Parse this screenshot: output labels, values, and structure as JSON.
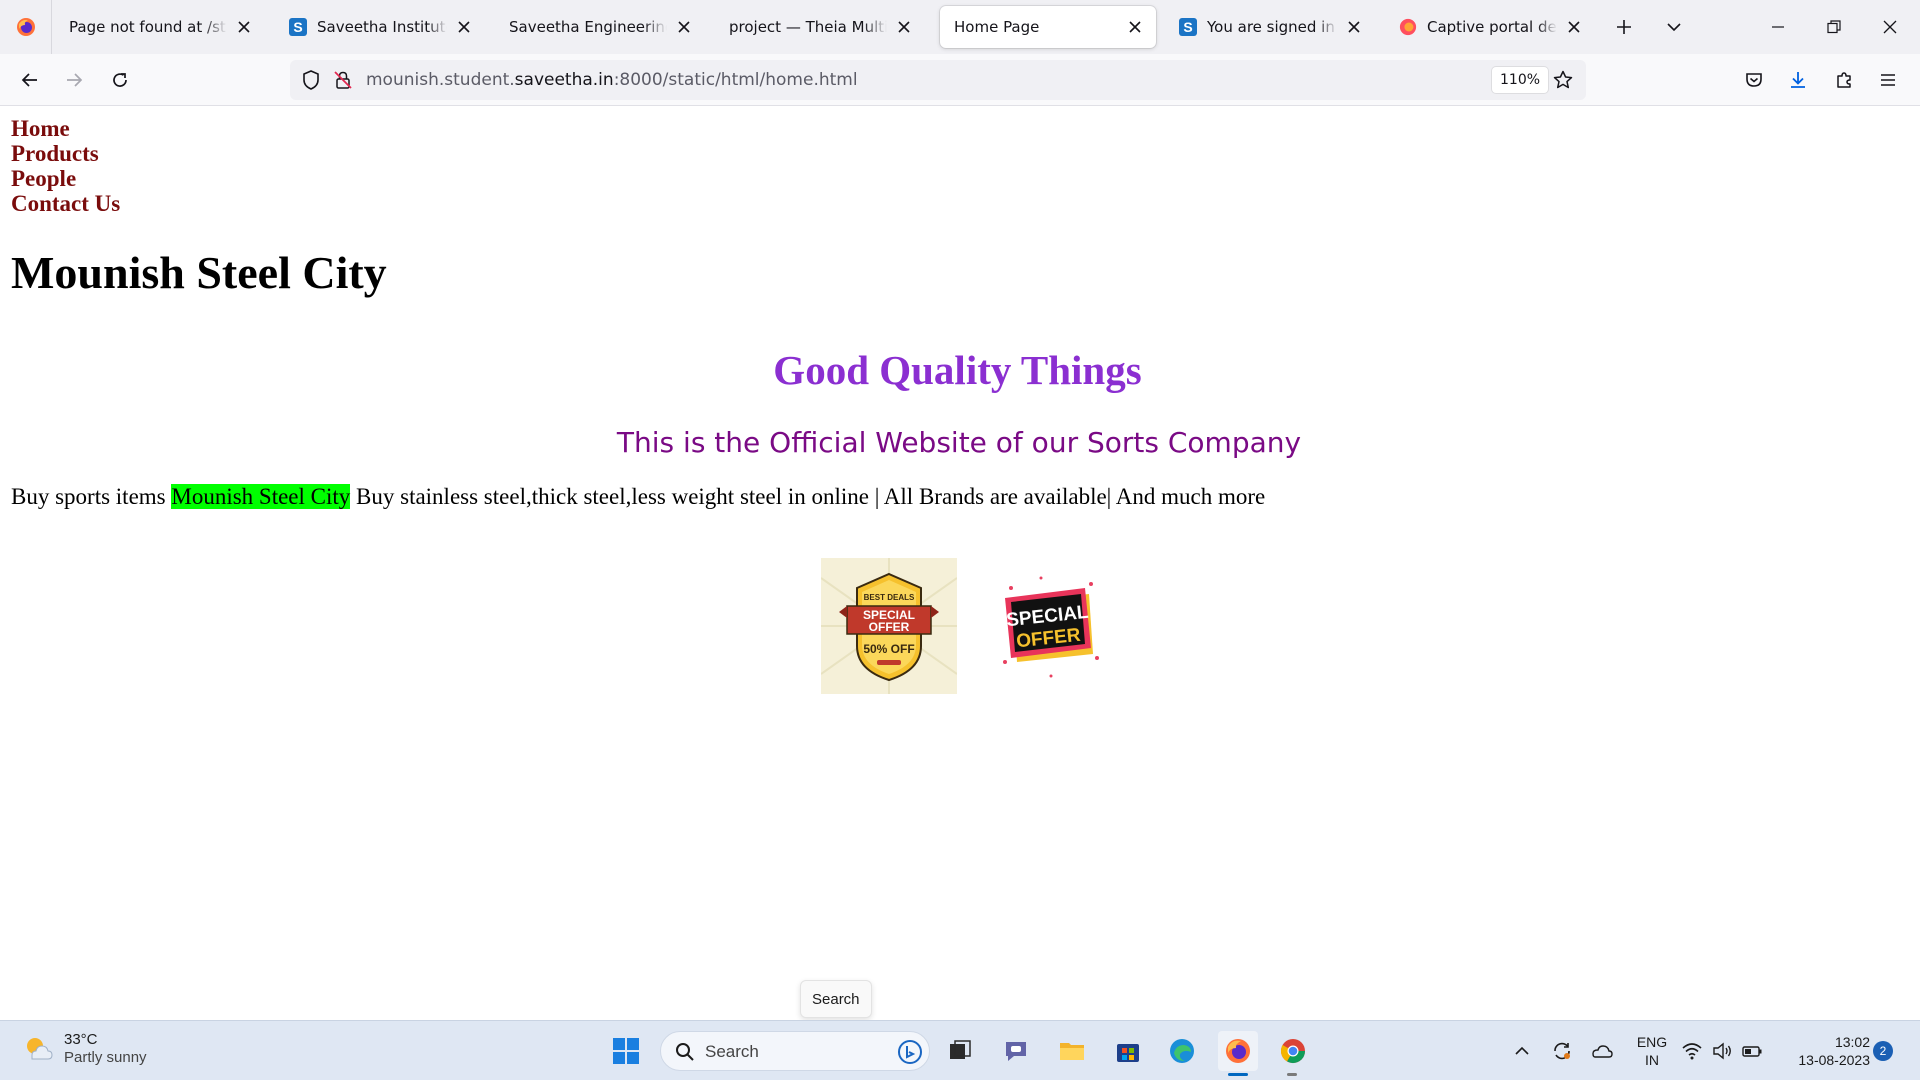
{
  "browser": {
    "tabs": [
      {
        "title": "Page not found at /static/h",
        "favicon": "firefox-page-icon",
        "active": false
      },
      {
        "title": "Saveetha Institute of M",
        "favicon": "saveetha-s-icon",
        "active": false
      },
      {
        "title": "Saveetha Engineering Colle",
        "favicon": "none",
        "active": false
      },
      {
        "title": "project — Theia Multi-Lang",
        "favicon": "none",
        "active": false
      },
      {
        "title": "Home Page",
        "favicon": "none",
        "active": true
      },
      {
        "title": "You are signed in as 22",
        "favicon": "saveetha-s-icon",
        "active": false
      },
      {
        "title": "Captive portal detecti",
        "favicon": "firefox-icon",
        "active": false
      }
    ],
    "url": {
      "prefix": "mounish.student.",
      "domain": "saveetha.in",
      "suffix": ":8000/static/html/home.html"
    },
    "zoom": "110%"
  },
  "page": {
    "nav": [
      "Home",
      "Products",
      "People",
      "Contact Us"
    ],
    "site_title": "Mounish Steel City",
    "tagline": "Good Quality Things",
    "subtitle": "This is the Official Website of our Sorts Company",
    "paragraph": {
      "before": "Buy sports items ",
      "highlight": "Mounish Steel City",
      "after": " Buy stainless steel,thick steel,less weight steel in online | All Brands are available| And much more"
    },
    "offer1": {
      "line1": "BEST DEALS",
      "line2": "SPECIAL",
      "line3": "OFFER",
      "line4": "50% OFF"
    },
    "offer2": {
      "line1": "SPECIAL",
      "line2": "OFFER"
    }
  },
  "tooltip": "Search",
  "taskbar": {
    "weather_temp": "33°C",
    "weather_condition": "Partly sunny",
    "search_label": "Search",
    "language_line1": "ENG",
    "language_line2": "IN",
    "time": "13:02",
    "date": "13-08-2023",
    "notification_count": "2"
  },
  "colors": {
    "nav_link": "#7a0c0c",
    "tagline": "#8b2fd1",
    "subtitle": "#7a0a85",
    "highlight": "#00ff00"
  }
}
